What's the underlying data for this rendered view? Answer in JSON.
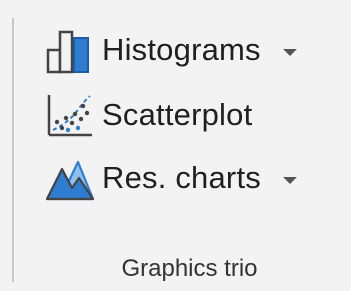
{
  "ribbon_group": {
    "title": "Graphics trio",
    "items": [
      {
        "label": "Histograms",
        "icon": "histogram-icon",
        "has_dropdown": true
      },
      {
        "label": "Scatterplot",
        "icon": "scatterplot-icon",
        "has_dropdown": false
      },
      {
        "label": "Res. charts",
        "icon": "res-charts-icon",
        "has_dropdown": true
      }
    ]
  },
  "colors": {
    "icon_blue": "#2f7dd1",
    "icon_light_blue": "#8fc1ee",
    "icon_dark": "#444444",
    "background": "#f3f3f3"
  }
}
